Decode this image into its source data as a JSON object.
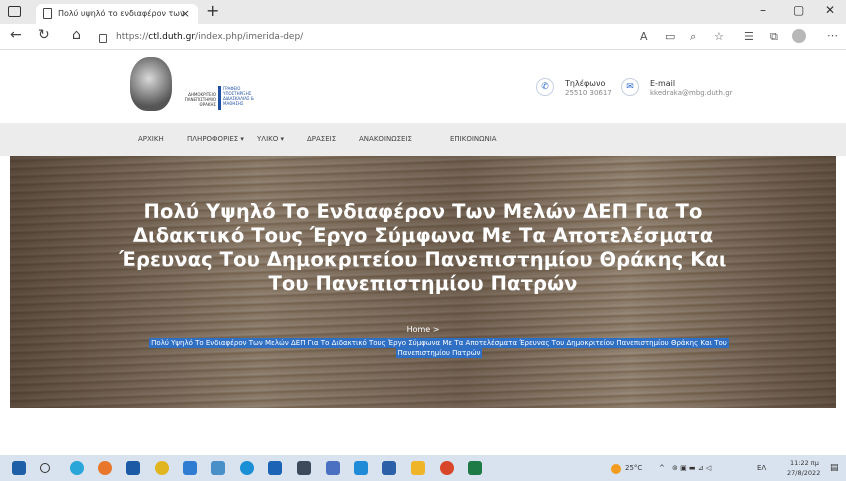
{
  "browser": {
    "tab_title": "Πολύ υψηλό το ενδιαφέρον των",
    "tab_close": "×",
    "new_tab": "+",
    "url_prefix": "https://",
    "url_host": "ctl.duth.gr",
    "url_path": "/index.php/imerida-dep/",
    "window_min": "–",
    "window_max": "▢",
    "window_close": "✕"
  },
  "site": {
    "logo_left": "ΔΗΜΟΚΡΙΤΕΙΟ ΠΑΝΕΠΙΣΤΗΜΙΟ ΘΡΑΚΗΣ",
    "logo_right": "ΓΡΑΦΕΙΟ ΥΠΟΣΤΗΡΙΞΗΣ ΔΙΔΑΣΚΑΛΙΑΣ & ΜΑΘΗΣΗΣ",
    "phone_title": "Τηλέφωνο",
    "phone_value": "25510 30617",
    "email_title": "E-mail",
    "email_value": "kkedraka@mbg.duth.gr"
  },
  "menu": {
    "items": [
      "ΑΡΧΙΚΗ",
      "ΠΛΗΡΟΦΟΡΙΕΣ ▾",
      "ΥΛΙΚΟ ▾",
      "ΔΡΑΣΕΙΣ",
      "ΑΝΑΚΟΙΝΩΣΕΙΣ",
      "ΕΠΙΚΟΙΝΩΝΙΑ"
    ]
  },
  "hero": {
    "title": "Πολύ Υψηλό Το Ενδιαφέρον Των Μελών ΔΕΠ Για Το Διδακτικό Τους Έργο Σύμφωνα Με Τα Αποτελέσματα Έρευνας Του Δημοκριτείου Πανεπιστημίου Θράκης Και Του Πανεπιστημίου Πατρών",
    "breadcrumb_home": "Home  >",
    "breadcrumb_current": "Πολύ Υψηλό Το Ενδιαφέρον Των Μελών ΔΕΠ Για Το Διδακτικό Τους Έργο Σύμφωνα Με Τα Αποτελέσματα Έρευνας Του Δημοκριτείου Πανεπιστημίου Θράκης Και Του Πανεπιστημίου Πατρών"
  },
  "taskbar": {
    "temperature": "25°C",
    "language": "ΕΛ",
    "time": "11:22 πμ",
    "date": "27/8/2022"
  },
  "colors": {
    "accent": "#2f6fc4",
    "menubar": "#ececec",
    "taskbar": "#d9e3ef"
  }
}
